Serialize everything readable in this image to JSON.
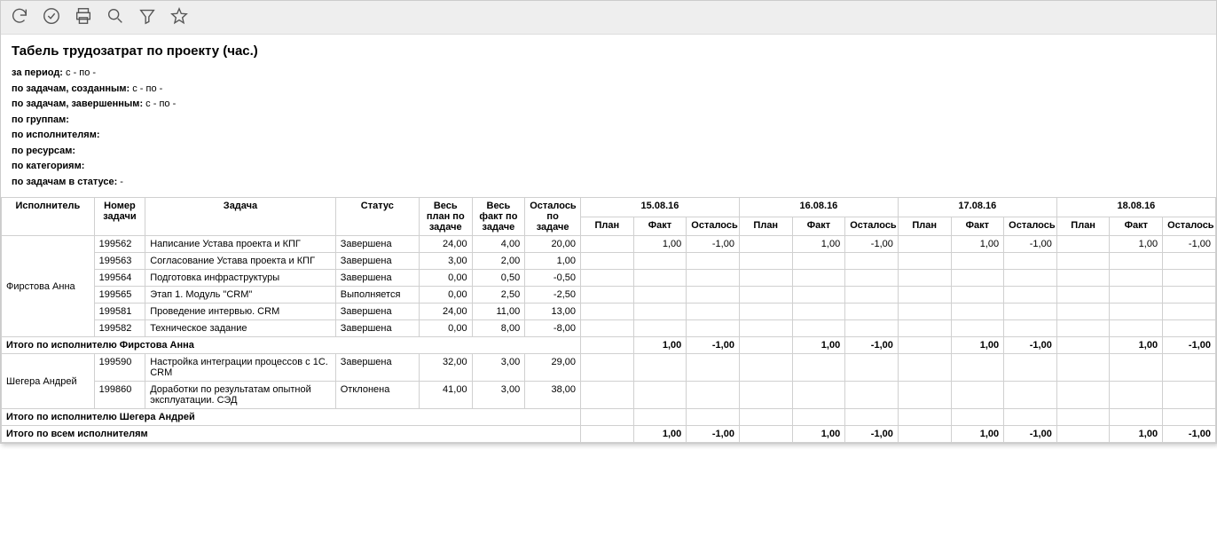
{
  "title": "Табель трудозатрат по проекту (час.)",
  "filters": [
    {
      "label": "за период:",
      "value": "с - по -"
    },
    {
      "label": "по задачам, созданным:",
      "value": "с - по -"
    },
    {
      "label": "по задачам, завершенным:",
      "value": "с - по -"
    },
    {
      "label": "по группам:",
      "value": ""
    },
    {
      "label": "по исполнителям:",
      "value": ""
    },
    {
      "label": "по ресурсам:",
      "value": ""
    },
    {
      "label": "по категориям:",
      "value": ""
    },
    {
      "label": "по задачам в статусе:",
      "value": " -"
    }
  ],
  "headers": {
    "executor": "Исполнитель",
    "task_no": "Номер задачи",
    "task": "Задача",
    "status": "Статус",
    "total_plan": "Весь план по задаче",
    "total_fact": "Весь факт по задаче",
    "total_remain": "Осталось по задаче",
    "sub_plan": "План",
    "sub_fact": "Факт",
    "sub_remain": "Осталось"
  },
  "dates": [
    "15.08.16",
    "16.08.16",
    "17.08.16",
    "18.08.16"
  ],
  "executors": [
    {
      "name": "Фирстова Анна",
      "tasks": [
        {
          "no": "199562",
          "name": "Написание Устава проекта и КПГ",
          "status": "Завершена",
          "plan": "24,00",
          "fact": "4,00",
          "remain": "20,00",
          "days": [
            [
              "",
              "1,00",
              "-1,00"
            ],
            [
              "",
              "1,00",
              "-1,00"
            ],
            [
              "",
              "1,00",
              "-1,00"
            ],
            [
              "",
              "1,00",
              "-1,00"
            ]
          ]
        },
        {
          "no": "199563",
          "name": "Согласование Устава проекта и КПГ",
          "status": "Завершена",
          "plan": "3,00",
          "fact": "2,00",
          "remain": "1,00",
          "days": [
            [
              "",
              "",
              ""
            ],
            [
              "",
              "",
              ""
            ],
            [
              "",
              "",
              ""
            ],
            [
              "",
              "",
              ""
            ]
          ]
        },
        {
          "no": "199564",
          "name": "Подготовка инфраструктуры",
          "status": "Завершена",
          "plan": "0,00",
          "fact": "0,50",
          "remain": "-0,50",
          "days": [
            [
              "",
              "",
              ""
            ],
            [
              "",
              "",
              ""
            ],
            [
              "",
              "",
              ""
            ],
            [
              "",
              "",
              ""
            ]
          ]
        },
        {
          "no": "199565",
          "name": "Этап 1. Модуль \"CRM\"",
          "status": "Выполняется",
          "plan": "0,00",
          "fact": "2,50",
          "remain": "-2,50",
          "days": [
            [
              "",
              "",
              ""
            ],
            [
              "",
              "",
              ""
            ],
            [
              "",
              "",
              ""
            ],
            [
              "",
              "",
              ""
            ]
          ]
        },
        {
          "no": "199581",
          "name": "Проведение интервью. CRM",
          "status": "Завершена",
          "plan": "24,00",
          "fact": "11,00",
          "remain": "13,00",
          "days": [
            [
              "",
              "",
              ""
            ],
            [
              "",
              "",
              ""
            ],
            [
              "",
              "",
              ""
            ],
            [
              "",
              "",
              ""
            ]
          ]
        },
        {
          "no": "199582",
          "name": "Техническое задание",
          "status": "Завершена",
          "plan": "0,00",
          "fact": "8,00",
          "remain": "-8,00",
          "days": [
            [
              "",
              "",
              ""
            ],
            [
              "",
              "",
              ""
            ],
            [
              "",
              "",
              ""
            ],
            [
              "",
              "",
              ""
            ]
          ]
        }
      ],
      "subtotal_label": "Итого по исполнителю Фирстова Анна",
      "subtotal_days": [
        [
          "",
          "1,00",
          "-1,00"
        ],
        [
          "",
          "1,00",
          "-1,00"
        ],
        [
          "",
          "1,00",
          "-1,00"
        ],
        [
          "",
          "1,00",
          "-1,00"
        ]
      ]
    },
    {
      "name": "Шегера Андрей",
      "tasks": [
        {
          "no": "199590",
          "name": "Настройка интеграции процессов с 1С. CRM",
          "status": "Завершена",
          "plan": "32,00",
          "fact": "3,00",
          "remain": "29,00",
          "days": [
            [
              "",
              "",
              ""
            ],
            [
              "",
              "",
              ""
            ],
            [
              "",
              "",
              ""
            ],
            [
              "",
              "",
              ""
            ]
          ]
        },
        {
          "no": "199860",
          "name": "Доработки по результатам опытной эксплуатации. СЭД",
          "status": "Отклонена",
          "plan": "41,00",
          "fact": "3,00",
          "remain": "38,00",
          "days": [
            [
              "",
              "",
              ""
            ],
            [
              "",
              "",
              ""
            ],
            [
              "",
              "",
              ""
            ],
            [
              "",
              "",
              ""
            ]
          ]
        }
      ],
      "subtotal_label": "Итого по исполнителю Шегера Андрей",
      "subtotal_days": [
        [
          "",
          "",
          ""
        ],
        [
          "",
          "",
          ""
        ],
        [
          "",
          "",
          ""
        ],
        [
          "",
          "",
          ""
        ]
      ]
    }
  ],
  "grand_label": "Итого по всем исполнителям",
  "grand_days": [
    [
      "",
      "1,00",
      "-1,00"
    ],
    [
      "",
      "1,00",
      "-1,00"
    ],
    [
      "",
      "1,00",
      "-1,00"
    ],
    [
      "",
      "1,00",
      "-1,00"
    ]
  ]
}
